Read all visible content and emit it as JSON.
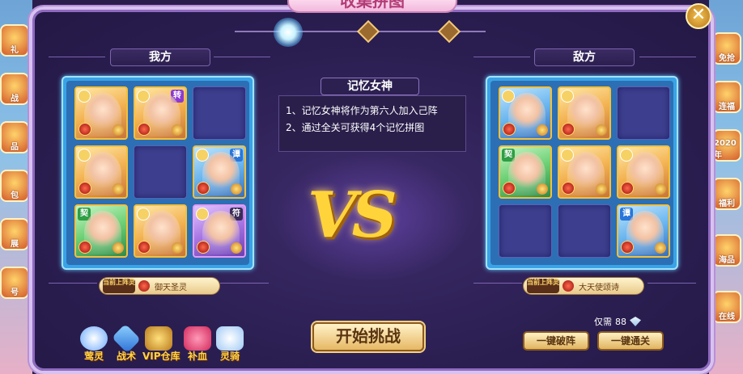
{
  "window": {
    "title": "收集拼图",
    "close_symbol": "✕"
  },
  "left_panel": {
    "header": "我方",
    "skill_badge": "当前上阵灵",
    "skill_name": "御天圣灵",
    "slots": [
      {
        "state": "filled",
        "color": "gold",
        "tag": ""
      },
      {
        "state": "filled",
        "color": "gold",
        "tag": "转"
      },
      {
        "state": "empty"
      },
      {
        "state": "filled",
        "color": "gold",
        "tag": ""
      },
      {
        "state": "empty"
      },
      {
        "state": "filled",
        "color": "blue",
        "tag": "谭"
      },
      {
        "state": "filled",
        "color": "green",
        "tag": "契"
      },
      {
        "state": "filled",
        "color": "gold",
        "tag": ""
      },
      {
        "state": "filled",
        "color": "purple",
        "tag": "符"
      }
    ]
  },
  "right_panel": {
    "header": "敌方",
    "skill_badge": "当前上阵灵",
    "skill_name": "大天使颂诗",
    "slots": [
      {
        "state": "filled",
        "color": "blue",
        "tag": ""
      },
      {
        "state": "filled",
        "color": "gold",
        "tag": ""
      },
      {
        "state": "empty"
      },
      {
        "state": "filled",
        "color": "green",
        "tag": "契"
      },
      {
        "state": "filled",
        "color": "gold",
        "tag": ""
      },
      {
        "state": "filled",
        "color": "gold",
        "tag": ""
      },
      {
        "state": "empty"
      },
      {
        "state": "empty"
      },
      {
        "state": "filled",
        "color": "blue",
        "tag": "谭"
      }
    ]
  },
  "info": {
    "title": "记忆女神",
    "line1": "1、记忆女神将作为第六人加入己阵",
    "line2": "2、通过全关可获得4个记忆拼图"
  },
  "vs_text": "VS",
  "start_button": "开始挑战",
  "bottom_icons": [
    {
      "label": "莺灵",
      "icon": "spirit-egg-icon"
    },
    {
      "label": "战术",
      "icon": "tactics-cube-icon"
    },
    {
      "label": "VIP仓库",
      "icon": "vip-warehouse-icon"
    },
    {
      "label": "补血",
      "icon": "heal-icon"
    },
    {
      "label": "灵骑",
      "icon": "mount-icon"
    }
  ],
  "cost": {
    "label": "仅需",
    "amount": "88"
  },
  "buttons": {
    "break_formation": "一键破阵",
    "clear_all": "一键通关"
  },
  "side_left_labels": [
    "礼",
    "战",
    "品",
    "包",
    "展",
    "号"
  ],
  "side_right_labels": [
    "免抢",
    "连福",
    "2020年",
    "福利",
    "海品",
    "在线"
  ]
}
